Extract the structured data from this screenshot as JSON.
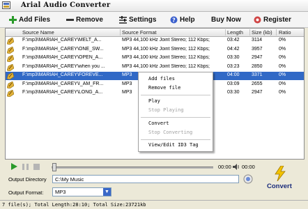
{
  "app": {
    "title": "Arial Audio Converter"
  },
  "toolbar": {
    "add_files": "Add Files",
    "remove": "Remove",
    "settings": "Settings",
    "help": "Help",
    "buy_now": "Buy Now",
    "register": "Register"
  },
  "columns": [
    "Source Name",
    "Source Format",
    "Length",
    "Size (kb)",
    "Ratio"
  ],
  "rows": [
    {
      "name": "F:\\mp3\\MARIAH_CAREY\\MELT_A...",
      "format": "MP3 44,100 kHz Joint Stereo; 112 Kbps;",
      "length": "03:42",
      "size": "3114",
      "ratio": "0%"
    },
    {
      "name": "F:\\mp3\\MARIAH_CAREY\\ONE_SW...",
      "format": "MP3 44,100 kHz Joint Stereo; 112 Kbps;",
      "length": "04:42",
      "size": "3957",
      "ratio": "0%"
    },
    {
      "name": "F:\\mp3\\MARIAH_CAREY\\OPEN_A...",
      "format": "MP3 44,100 kHz Joint Stereo; 112 Kbps;",
      "length": "03:30",
      "size": "2947",
      "ratio": "0%"
    },
    {
      "name": "F:\\mp3\\MARIAH_CAREY\\when you ...",
      "format": "MP3 44,100 kHz Joint Stereo; 112 Kbps;",
      "length": "03:23",
      "size": "2850",
      "ratio": "0%"
    },
    {
      "name": "F:\\mp3\\MARIAH_CAREY\\FOREVE...",
      "format": "MP3",
      "length": "04:00",
      "size": "3371",
      "ratio": "0%",
      "selected": true
    },
    {
      "name": "F:\\mp3\\MARIAH_CAREY\\I_AM_FR...",
      "format": "MP3",
      "length": "03:09",
      "size": "2655",
      "ratio": "0%"
    },
    {
      "name": "F:\\mp3\\MARIAH_CAREY\\LONG_A...",
      "format": "MP3",
      "length": "03:30",
      "size": "2947",
      "ratio": "0%"
    }
  ],
  "context_menu": {
    "add_files": "Add files",
    "remove_file": "Remove file",
    "play": "Play",
    "stop_playing": "Stop Playing",
    "convert": "Convert",
    "stop_converting": "Stop Converting",
    "view_edit_id3": "View/Edit ID3 Tag"
  },
  "player": {
    "current_time": "00:00",
    "total_time": "00:00"
  },
  "output": {
    "directory_label": "Output Directory",
    "directory_value": "C:\\My Music",
    "format_label": "Output Format:",
    "format_value": "MP3"
  },
  "convert_label": "Convert",
  "status": "7 file(s); Total Length:28:10; Total Size:23721kb"
}
